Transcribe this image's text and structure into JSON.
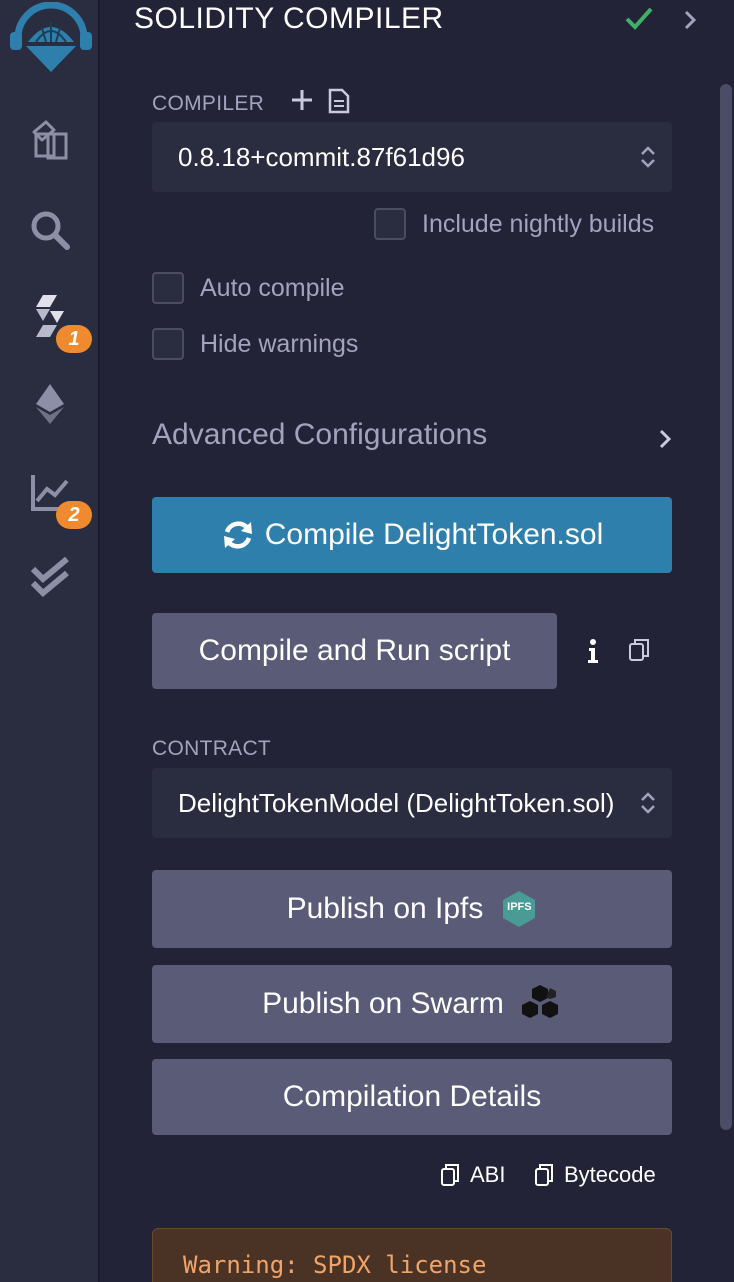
{
  "rail": {
    "items": [
      {
        "icon": "remix-logo-icon"
      },
      {
        "icon": "file-explorer-icon"
      },
      {
        "icon": "search-icon"
      },
      {
        "icon": "solidity-compiler-icon",
        "badge": "1"
      },
      {
        "icon": "deploy-run-icon"
      },
      {
        "icon": "analysis-icon",
        "badge": "2"
      },
      {
        "icon": "test-icon"
      }
    ]
  },
  "header": {
    "title": "SOLIDITY COMPILER",
    "status_icon": "check-icon",
    "collapse_icon": "chevron-right-icon"
  },
  "compiler": {
    "label": "COMPILER",
    "add_icon": "plus-icon",
    "doc_icon": "document-icon",
    "version": "0.8.18+commit.87f61d96",
    "include_nightly": "Include nightly builds"
  },
  "options": {
    "auto_compile": "Auto compile",
    "hide_warnings": "Hide warnings"
  },
  "advanced": {
    "label": "Advanced Configurations"
  },
  "actions": {
    "compile": "Compile DelightToken.sol",
    "compile_run": "Compile and Run script"
  },
  "contract": {
    "label": "CONTRACT",
    "selected": "DelightTokenModel (DelightToken.sol)"
  },
  "publish": {
    "ipfs": "Publish on Ipfs",
    "ipfs_badge": "IPFS",
    "swarm": "Publish on Swarm",
    "details": "Compilation Details"
  },
  "copy": {
    "abi": "ABI",
    "bytecode": "Bytecode"
  },
  "warning": {
    "text": "Warning: SPDX license"
  },
  "colors": {
    "accent": "#2f7fad",
    "badge": "#f08a2e",
    "success": "#3fb068",
    "warning": "#f0a46a"
  }
}
